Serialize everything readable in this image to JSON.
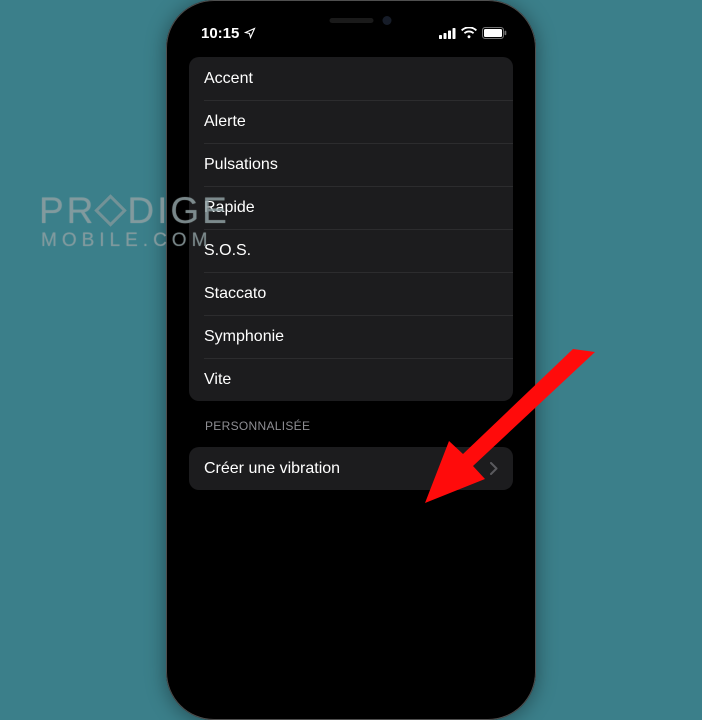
{
  "status_bar": {
    "time": "10:15",
    "location_icon": "location-arrow",
    "signal_bars": 4,
    "wifi": true,
    "battery_full": true
  },
  "standard_group": {
    "items": [
      {
        "label": "Accent"
      },
      {
        "label": "Alerte"
      },
      {
        "label": "Pulsations"
      },
      {
        "label": "Rapide"
      },
      {
        "label": "S.O.S."
      },
      {
        "label": "Staccato"
      },
      {
        "label": "Symphonie"
      },
      {
        "label": "Vite"
      }
    ]
  },
  "custom_section": {
    "header": "PERSONNALISÉE",
    "create_label": "Créer une vibration"
  },
  "watermark": {
    "line1a": "PR",
    "line1b": "DIGE",
    "line2": "MOBILE.COM"
  },
  "annotation": {
    "arrow_color": "#ff0b0b"
  }
}
